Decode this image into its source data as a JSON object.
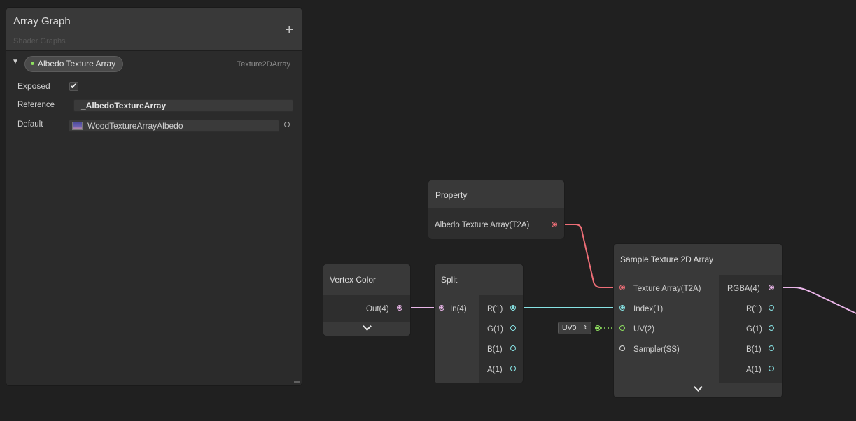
{
  "blackboard": {
    "title": "Array Graph",
    "subtitle": "Shader Graphs",
    "add_label": "+",
    "property": {
      "name": "Albedo Texture Array",
      "type": "Texture2DArray",
      "exposed_label": "Exposed",
      "exposed_checked": true,
      "check_glyph": "✔",
      "reference_label": "Reference",
      "reference_value": "_AlbedoTextureArray",
      "default_label": "Default",
      "default_value": "WoodTextureArrayAlbedo"
    }
  },
  "nodes": {
    "property": {
      "title": "Property",
      "output": "Albedo Texture Array(T2A)"
    },
    "vertex_color": {
      "title": "Vertex Color",
      "output": "Out(4)"
    },
    "split": {
      "title": "Split",
      "input": "In(4)",
      "outputs": [
        "R(1)",
        "G(1)",
        "B(1)",
        "A(1)"
      ]
    },
    "sample": {
      "title": "Sample Texture 2D Array",
      "inputs": [
        "Texture Array(T2A)",
        "Index(1)",
        "UV(2)",
        "Sampler(SS)"
      ],
      "outputs": [
        "RGBA(4)",
        "R(1)",
        "G(1)",
        "B(1)",
        "A(1)"
      ]
    },
    "uv_field": {
      "value": "UV0",
      "arrows": "⇕"
    }
  },
  "colors": {
    "texture_port": "#ee6e77",
    "vector4_port": "#e9b5e8",
    "float_port": "#87e3e4",
    "vector2_port": "#8ee05f",
    "graph_bg": "#202020"
  }
}
